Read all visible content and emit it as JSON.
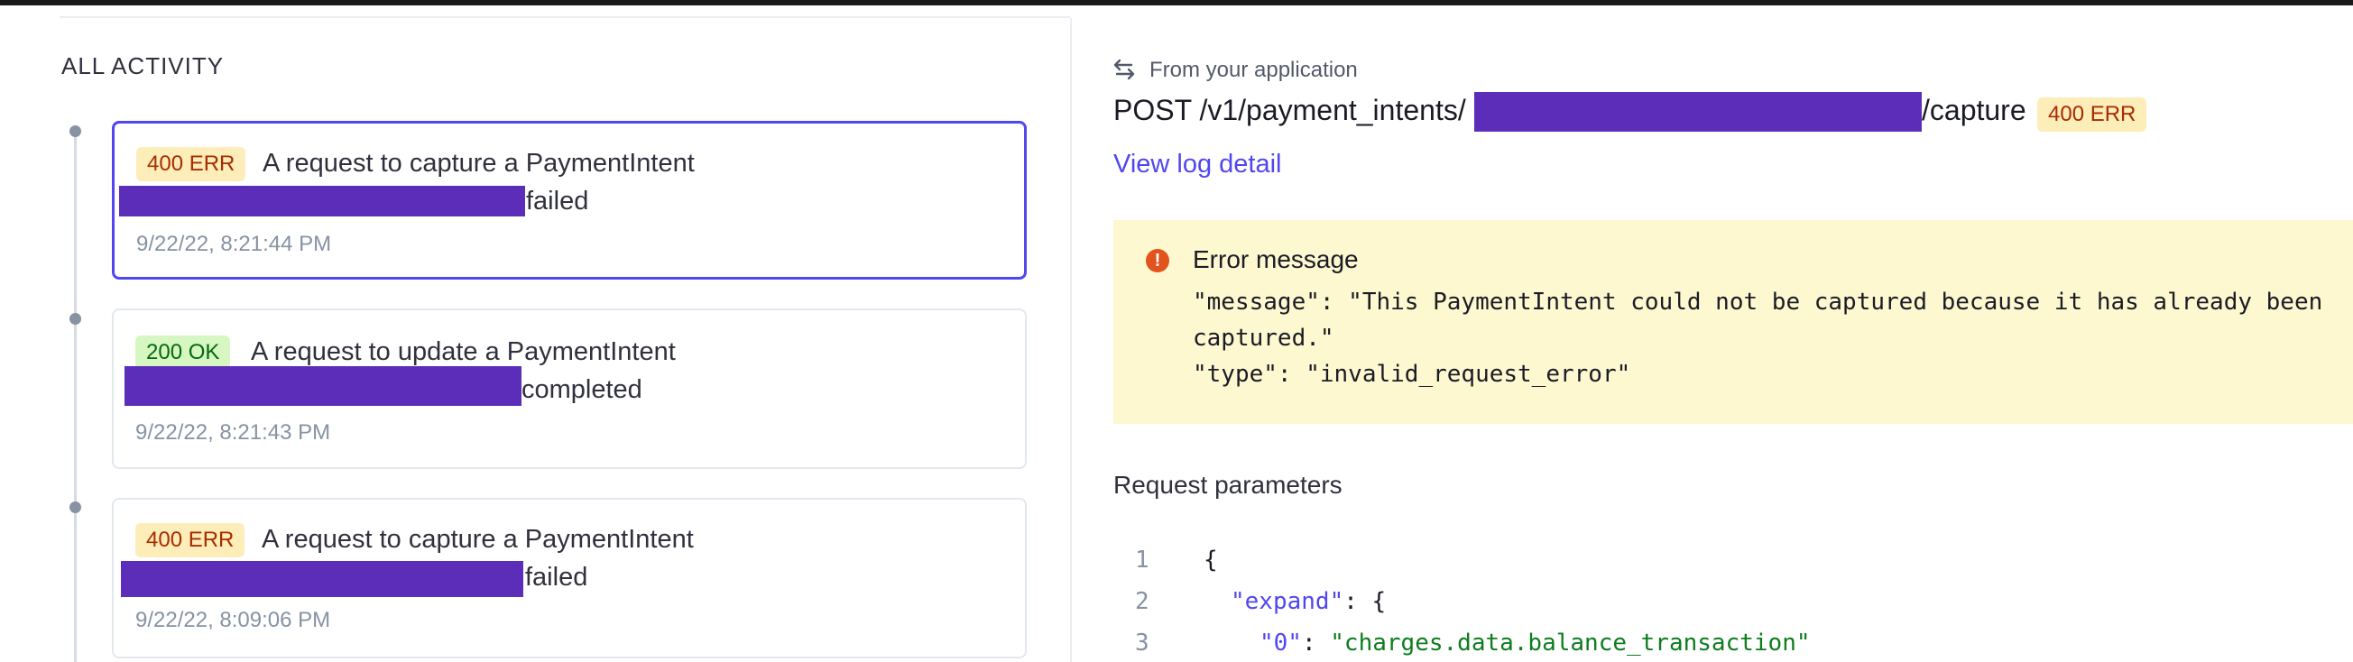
{
  "activity": {
    "title": "ALL ACTIVITY",
    "items": [
      {
        "status": "400 ERR",
        "status_type": "error",
        "text": "A request to capture a PaymentIntent",
        "suffix": "failed",
        "time": "9/22/22, 8:21:44 PM"
      },
      {
        "status": "200 OK",
        "status_type": "ok",
        "text": "A request to update a PaymentIntent",
        "suffix": "completed",
        "time": "9/22/22, 8:21:43 PM"
      },
      {
        "status": "400 ERR",
        "status_type": "error",
        "text": "A request to capture a PaymentIntent",
        "suffix": "failed",
        "time": "9/22/22, 8:09:06 PM"
      }
    ]
  },
  "detail": {
    "origin": "From your application",
    "method_path": "POST /v1/payment_intents/",
    "path_suffix": "/capture",
    "status": "400 ERR",
    "view_log": "View log detail",
    "error": {
      "title": "Error message",
      "line1": "\"message\": \"This PaymentIntent could not be captured because it has already been",
      "line2": "captured.\"",
      "line3": "\"type\": \"invalid_request_error\""
    },
    "request_params": {
      "title": "Request parameters",
      "line_numbers": [
        "1",
        "2",
        "3"
      ],
      "open_brace": "{",
      "expand_key": "\"expand\"",
      "expand_sep": ": {",
      "item_key": "\"0\"",
      "item_sep": ": ",
      "item_value": "\"charges.data.balance_transaction\""
    }
  },
  "colors": {
    "accent": "#5146f0",
    "error_bg": "#fcedb9",
    "ok_bg": "#d7f7c2",
    "redaction": "#5b2db8"
  },
  "icons": {
    "origin": "arrows-exchange-icon",
    "error": "exclamation-circle-icon"
  }
}
